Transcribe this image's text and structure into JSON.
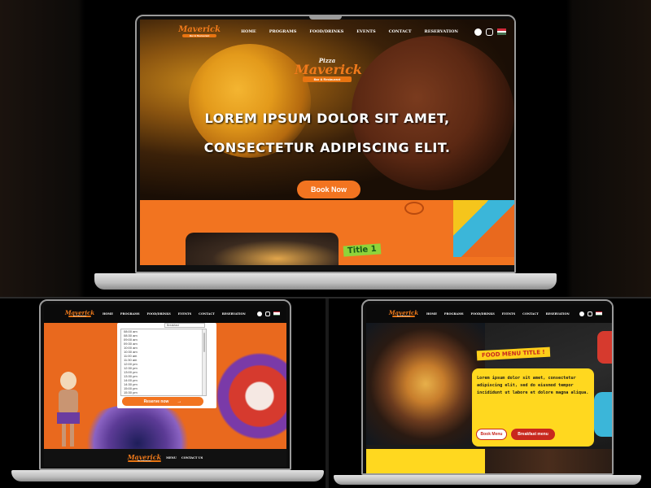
{
  "brand": {
    "logo_top": "Pizza",
    "logo_main": "Maverick",
    "logo_sub": "Bar & Restaurant"
  },
  "nav": {
    "items": [
      "HOME",
      "PROGRAMS",
      "FOOD/DRINKS",
      "EVENTS",
      "CONTACT",
      "RESERVATION"
    ]
  },
  "hero": {
    "line1": "LOREM IPSUM DOLOR SIT AMET,",
    "line2": "CONSECTETUR ADIPISCING ELIT.",
    "book_now": "Book Now",
    "section_title": "Title 1"
  },
  "reservation": {
    "selected_option": "Breakfast",
    "times": [
      "08:00 am",
      "08:30 am",
      "09:00 am",
      "09:30 am",
      "10:00 am",
      "10:30 am",
      "11:00 am",
      "11:30 am",
      "12:00 pm",
      "12:30 pm",
      "13:00 pm",
      "13:30 pm",
      "14:00 pm",
      "14:30 pm",
      "15:00 pm",
      "15:30 pm",
      "16:00 pm",
      "16:30 pm"
    ],
    "reserve_button": "Reserve now",
    "footer_links": [
      "MENU",
      "CONTACT US"
    ]
  },
  "food_menu": {
    "title": "FOOD MENU TITLE !",
    "description": "Lorem ipsum dolor sit amet, consectetur adipiscing elit, sed do eiusmod tempor incididunt ut labore et dolore magna aliqua.",
    "book_menu": "Book Menu",
    "breakfast_menu": "Breakfast menu"
  },
  "colors": {
    "accent_orange": "#f27420",
    "menu_yellow": "#ffd81f",
    "menu_red": "#c8281e",
    "lime": "#8fd43a"
  },
  "icons": [
    "facebook-icon",
    "instagram-icon",
    "hungarian-flag-icon",
    "arrow-right-icon"
  ]
}
